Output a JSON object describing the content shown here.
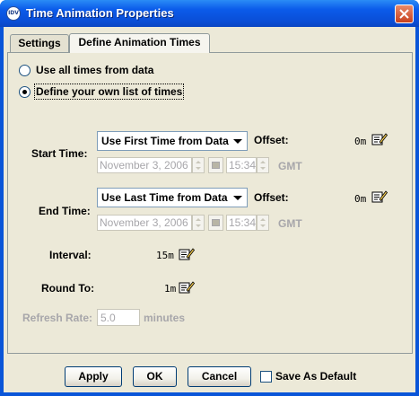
{
  "window": {
    "title": "Time Animation Properties",
    "app_icon_text": "IDV"
  },
  "tabs": [
    {
      "label": "Settings",
      "active": false
    },
    {
      "label": "Define Animation Times",
      "active": true
    }
  ],
  "mode": {
    "options": [
      {
        "label": "Use all times from data",
        "selected": false
      },
      {
        "label": "Define your own list of times",
        "selected": true
      }
    ]
  },
  "start": {
    "label": "Start Time:",
    "combo": "Use First Time from Data",
    "offset_label": "Offset:",
    "offset_value": "0m",
    "date": "November 3, 2006",
    "time": "15:34",
    "tz": "GMT"
  },
  "end": {
    "label": "End Time:",
    "combo": "Use Last Time from Data",
    "offset_label": "Offset:",
    "offset_value": "0m",
    "date": "November 3, 2006",
    "time": "15:34",
    "tz": "GMT"
  },
  "interval": {
    "label": "Interval:",
    "value": "15m"
  },
  "round_to": {
    "label": "Round To:",
    "value": "1m"
  },
  "refresh": {
    "label": "Refresh Rate:",
    "value": "5.0",
    "units": "minutes"
  },
  "buttons": {
    "apply": "Apply",
    "ok": "OK",
    "cancel": "Cancel",
    "save_default": "Save As Default"
  },
  "icons": {
    "app": "idv-logo-icon",
    "close": "close-icon",
    "edit": "edit-icon",
    "dropdown": "chevron-down-icon",
    "calendar": "calendar-icon",
    "spinner": "spinner-arrows-icon"
  },
  "colors": {
    "titlebar": "#0a55d8",
    "dialog_bg": "#ece9d8",
    "close_btn": "#c8401d",
    "disabled_text": "#a7a6aa"
  }
}
